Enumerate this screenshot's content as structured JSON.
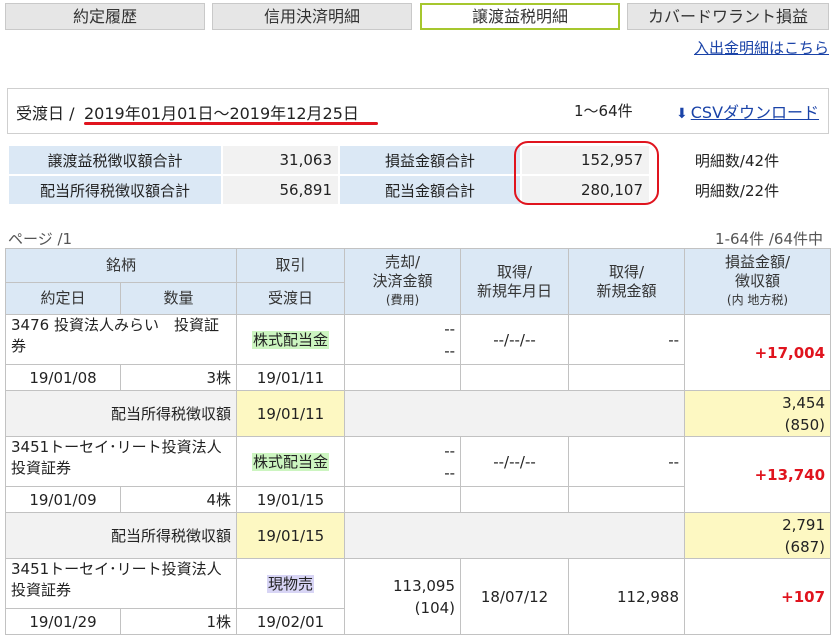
{
  "tabs": [
    {
      "label": "約定履歴",
      "active": false
    },
    {
      "label": "信用決済明細",
      "active": false
    },
    {
      "label": "譲渡益税明細",
      "active": true
    },
    {
      "label": "カバードワラント損益",
      "active": false
    }
  ],
  "deposit_link": "入出金明細はこちら",
  "period": {
    "label": "受渡日 /",
    "range": "2019年01月01日～2019年12月25日",
    "count": "1～64件",
    "csv_label": "CSVダウンロード"
  },
  "summary": {
    "row1": {
      "label": "譲渡益税徴収額合計",
      "value": "31,063",
      "label2": "損益金額合計",
      "value2": "152,957",
      "count": "明細数/42件"
    },
    "row2": {
      "label": "配当所得税徴収額合計",
      "value": "56,891",
      "label2": "配当金額合計",
      "value2": "280,107",
      "count": "明細数/22件"
    }
  },
  "paging": {
    "page": "ページ /1",
    "range": "1-64件 /64件中"
  },
  "headers": {
    "meigara": "銘柄",
    "torihiki": "取引",
    "baikyaku_1": "売却/",
    "baikyaku_2": "決済金額",
    "baikyaku_3": "(費用)",
    "shutoku_date_1": "取得/",
    "shutoku_date_2": "新規年月日",
    "shutoku_amt_1": "取得/",
    "shutoku_amt_2": "新規金額",
    "pl_1": "損益金額/",
    "pl_2": "徴収額",
    "pl_3": "(内 地方税)",
    "yakujo": "約定日",
    "suryo": "数量",
    "ukewatashi": "受渡日"
  },
  "rows": [
    {
      "name": "3476 投資法人みらい　投資証券",
      "type": "株式配当金",
      "sale1": "--",
      "sale2": "--",
      "acq_date": "--/--/--",
      "acq_amt": "--",
      "pl": "+17,004",
      "trade_date": "19/01/08",
      "qty": "3株",
      "settle_date": "19/01/11"
    },
    {
      "tax_label": "配当所得税徴収額",
      "tax_date": "19/01/11",
      "tax1": "3,454",
      "tax2": "(850)"
    },
    {
      "name": "3451トーセイ･リート投資法人　投資証券",
      "type": "株式配当金",
      "sale1": "--",
      "sale2": "--",
      "acq_date": "--/--/--",
      "acq_amt": "--",
      "pl": "+13,740",
      "trade_date": "19/01/09",
      "qty": "4株",
      "settle_date": "19/01/15"
    },
    {
      "tax_label": "配当所得税徴収額",
      "tax_date": "19/01/15",
      "tax1": "2,791",
      "tax2": "(687)"
    },
    {
      "name": "3451トーセイ･リート投資法人　投資証券",
      "type": "現物売",
      "sale1": "113,095",
      "sale2": "(104)",
      "acq_date": "18/07/12",
      "acq_amt": "112,988",
      "pl": "+107",
      "trade_date": "19/01/29",
      "qty": "1株",
      "settle_date": "19/02/01"
    }
  ]
}
